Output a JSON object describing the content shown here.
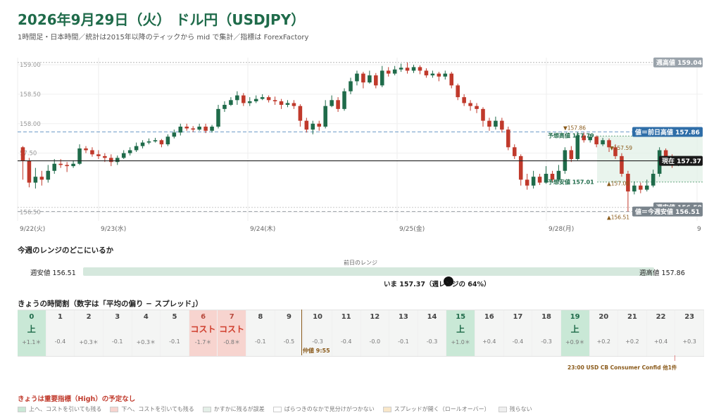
{
  "header": {
    "title": "2026年9月29日（火） ドル円（USDJPY）",
    "subtitle": "1時間足・日本時間／統計は2015年以降のティックから mid で集計／指標は ForexFactory"
  },
  "chart_data": {
    "type": "candlestick",
    "ylim": [
      156.35,
      159.12
    ],
    "y_ticks": [
      "159.00",
      "158.50",
      "158.00",
      "57.50",
      "156.50"
    ],
    "x_ticks": [
      "9/22(火)",
      "9/23(水)",
      "9/24(木)",
      "9/25(金)",
      "9/28(月)",
      "9"
    ],
    "colors": {
      "up": "#1f6b4a",
      "down": "#c0392b"
    },
    "candles": [
      [
        157.6,
        157.37,
        157.62,
        157.05
      ],
      [
        157.37,
        157.0,
        157.42,
        156.92
      ],
      [
        157.0,
        157.1,
        157.25,
        156.9
      ],
      [
        157.1,
        157.05,
        157.2,
        156.95
      ],
      [
        157.05,
        157.2,
        157.3,
        157.0
      ],
      [
        157.2,
        157.32,
        157.4,
        157.15
      ],
      [
        157.32,
        157.3,
        157.4,
        157.25
      ],
      [
        157.3,
        157.28,
        157.35,
        157.18
      ],
      [
        157.28,
        157.32,
        157.38,
        157.25
      ],
      [
        157.32,
        157.58,
        157.65,
        157.3
      ],
      [
        157.58,
        157.55,
        157.62,
        157.5
      ],
      [
        157.55,
        157.48,
        157.6,
        157.44
      ],
      [
        157.48,
        157.45,
        157.55,
        157.4
      ],
      [
        157.45,
        157.42,
        157.5,
        157.35
      ],
      [
        157.42,
        157.35,
        157.48,
        157.28
      ],
      [
        157.35,
        157.42,
        157.46,
        157.3
      ],
      [
        157.42,
        157.5,
        157.55,
        157.4
      ],
      [
        157.5,
        157.55,
        157.6,
        157.46
      ],
      [
        157.55,
        157.62,
        157.68,
        157.52
      ],
      [
        157.62,
        157.68,
        157.72,
        157.58
      ],
      [
        157.68,
        157.7,
        157.75,
        157.65
      ],
      [
        157.7,
        157.72,
        157.76,
        157.68
      ],
      [
        157.72,
        157.65,
        157.74,
        157.6
      ],
      [
        157.65,
        157.78,
        157.82,
        157.62
      ],
      [
        157.78,
        157.85,
        157.9,
        157.75
      ],
      [
        157.85,
        157.95,
        158.0,
        157.8
      ],
      [
        157.95,
        157.92,
        158.0,
        157.88
      ],
      [
        157.92,
        157.9,
        157.96,
        157.86
      ],
      [
        157.9,
        157.95,
        158.0,
        157.88
      ],
      [
        157.95,
        157.88,
        158.0,
        157.84
      ],
      [
        157.88,
        157.95,
        157.98,
        157.85
      ],
      [
        157.95,
        158.25,
        158.32,
        157.92
      ],
      [
        158.25,
        158.32,
        158.38,
        158.2
      ],
      [
        158.32,
        158.4,
        158.45,
        158.3
      ],
      [
        158.4,
        158.48,
        158.55,
        158.32
      ],
      [
        158.48,
        158.35,
        158.52,
        158.3
      ],
      [
        158.35,
        158.38,
        158.45,
        158.3
      ],
      [
        158.38,
        158.42,
        158.48,
        158.35
      ],
      [
        158.42,
        158.45,
        158.5,
        158.4
      ],
      [
        158.45,
        158.4,
        158.48,
        158.36
      ],
      [
        158.4,
        158.38,
        158.46,
        158.32
      ],
      [
        158.38,
        158.32,
        158.42,
        158.25
      ],
      [
        158.32,
        158.35,
        158.4,
        158.28
      ],
      [
        158.35,
        158.3,
        158.4,
        158.25
      ],
      [
        158.3,
        158.05,
        158.33,
        157.95
      ],
      [
        158.05,
        157.9,
        158.1,
        157.85
      ],
      [
        157.9,
        158.0,
        158.05,
        157.82
      ],
      [
        158.0,
        157.95,
        158.05,
        157.88
      ],
      [
        157.95,
        158.3,
        158.4,
        157.92
      ],
      [
        158.3,
        158.4,
        158.48,
        158.28
      ],
      [
        158.4,
        158.25,
        158.45,
        158.2
      ],
      [
        158.25,
        158.55,
        158.6,
        158.22
      ],
      [
        158.55,
        158.72,
        158.78,
        158.5
      ],
      [
        158.72,
        158.85,
        158.9,
        158.65
      ],
      [
        158.85,
        158.7,
        158.88,
        158.6
      ],
      [
        158.7,
        158.82,
        158.9,
        158.68
      ],
      [
        158.82,
        158.65,
        158.86,
        158.6
      ],
      [
        158.65,
        158.9,
        158.98,
        158.62
      ],
      [
        158.9,
        158.85,
        158.96,
        158.8
      ],
      [
        158.85,
        158.92,
        158.98,
        158.82
      ],
      [
        158.92,
        158.95,
        159.02,
        158.88
      ],
      [
        158.95,
        158.9,
        159.04,
        158.85
      ],
      [
        158.9,
        158.96,
        159.0,
        158.86
      ],
      [
        158.96,
        158.9,
        158.99,
        158.84
      ],
      [
        158.9,
        158.82,
        158.94,
        158.78
      ],
      [
        158.82,
        158.85,
        158.9,
        158.78
      ],
      [
        158.85,
        158.8,
        158.88,
        158.72
      ],
      [
        158.8,
        158.85,
        158.9,
        158.75
      ],
      [
        158.85,
        158.65,
        158.88,
        158.6
      ],
      [
        158.65,
        158.45,
        158.68,
        158.4
      ],
      [
        158.45,
        158.35,
        158.5,
        158.3
      ],
      [
        158.35,
        158.3,
        158.4,
        158.22
      ],
      [
        158.3,
        158.25,
        158.35,
        158.18
      ],
      [
        158.25,
        158.05,
        158.28,
        157.95
      ],
      [
        158.05,
        157.95,
        158.1,
        157.88
      ],
      [
        157.95,
        158.05,
        158.12,
        157.9
      ],
      [
        158.05,
        157.9,
        158.1,
        157.85
      ],
      [
        157.9,
        157.6,
        157.95,
        157.55
      ],
      [
        157.6,
        157.45,
        157.65,
        157.4
      ],
      [
        157.45,
        157.05,
        157.48,
        156.95
      ],
      [
        157.05,
        156.95,
        157.15,
        156.88
      ],
      [
        156.95,
        157.1,
        157.2,
        156.9
      ],
      [
        157.1,
        157.0,
        157.15,
        156.96
      ],
      [
        157.0,
        157.15,
        157.28,
        156.98
      ],
      [
        157.15,
        157.05,
        157.2,
        157.0
      ],
      [
        157.05,
        157.2,
        157.3,
        157.02
      ],
      [
        157.2,
        157.55,
        157.6,
        157.15
      ],
      [
        157.55,
        157.4,
        157.62,
        157.35
      ],
      [
        157.4,
        157.8,
        157.86,
        157.38
      ],
      [
        157.8,
        157.72,
        157.85,
        157.68
      ],
      [
        157.72,
        157.78,
        157.82,
        157.68
      ],
      [
        157.78,
        157.65,
        157.8,
        157.6
      ],
      [
        157.65,
        157.72,
        157.76,
        157.62
      ],
      [
        157.72,
        157.6,
        157.75,
        157.52
      ],
      [
        157.6,
        157.45,
        157.65,
        157.4
      ],
      [
        157.45,
        157.15,
        157.5,
        157.1
      ],
      [
        157.15,
        156.85,
        157.2,
        156.51
      ],
      [
        156.85,
        156.95,
        157.02,
        156.8
      ],
      [
        156.95,
        156.88,
        157.0,
        156.82
      ],
      [
        156.88,
        156.95,
        157.05,
        156.85
      ],
      [
        156.95,
        157.15,
        157.22,
        156.92
      ],
      [
        157.15,
        157.55,
        157.6,
        157.1
      ],
      [
        157.55,
        157.4,
        157.58,
        157.3
      ],
      [
        157.4,
        157.3,
        157.48,
        157.25
      ],
      [
        157.3,
        157.37,
        157.45,
        157.28
      ]
    ],
    "levels": {
      "week_high_line": 159.04,
      "prev_day_high_line": 157.86,
      "current_line": 157.37,
      "week_low_line": 156.51,
      "forecast_high": 157.79,
      "forecast_low": 157.01
    },
    "right_labels": {
      "week_high": "週高値 159.04",
      "prev_day_high": "値＝前日高値 157.86",
      "current": "現在 157.37",
      "week_low_line": "週安値 156.58",
      "week_low_today": "値＝今週安値 156.51"
    },
    "annotations": {
      "forecast_high": "予想高値 157.79",
      "forecast_low": "予想安値 157.01",
      "prev_high_marker": "▼157.86",
      "today_high_marker": "▼157.59",
      "today_low_marker": "▲157.00",
      "week_low_marker": "▲156.51"
    },
    "colors_levels": {
      "week_high_bg": "#9aa3ab",
      "prev_high_bg": "#2f6ea8",
      "current_bg": "#1a1a1a",
      "low_bg": "#7a848c",
      "forecast": "#1f6b4a",
      "marker": "#8a5a1a"
    }
  },
  "range": {
    "heading": "今週のレンジのどこにいるか",
    "caption": "前日のレンジ",
    "low_label": "週安値 156.51",
    "high_label": "週高値 157.86",
    "now_label": "いま 157.37（週レンジの 64%）",
    "position_pct": 64
  },
  "schedule": {
    "heading": "きょうの時間割（数字は「平均の偏り − スプレッド」）",
    "hours": [
      {
        "h": "0",
        "label": "上",
        "value": "+1.1＊",
        "type": "up"
      },
      {
        "h": "1",
        "label": "",
        "value": "-0.4",
        "type": ""
      },
      {
        "h": "2",
        "label": "",
        "value": "+0.3＊",
        "type": ""
      },
      {
        "h": "3",
        "label": "",
        "value": "-0.1",
        "type": ""
      },
      {
        "h": "4",
        "label": "",
        "value": "+0.3＊",
        "type": ""
      },
      {
        "h": "5",
        "label": "",
        "value": "-0.1",
        "type": ""
      },
      {
        "h": "6",
        "label": "コスト",
        "value": "-1.7＊",
        "type": "cost"
      },
      {
        "h": "7",
        "label": "コスト",
        "value": "-0.8＊",
        "type": "cost"
      },
      {
        "h": "8",
        "label": "",
        "value": "-0.1",
        "type": ""
      },
      {
        "h": "9",
        "label": "",
        "value": "-0.5",
        "type": ""
      },
      {
        "h": "10",
        "label": "",
        "value": "-0.3",
        "type": ""
      },
      {
        "h": "11",
        "label": "",
        "value": "-0.4",
        "type": ""
      },
      {
        "h": "12",
        "label": "",
        "value": "-0.0",
        "type": ""
      },
      {
        "h": "13",
        "label": "",
        "value": "-0.1",
        "type": ""
      },
      {
        "h": "14",
        "label": "",
        "value": "-0.3",
        "type": ""
      },
      {
        "h": "15",
        "label": "上",
        "value": "+1.0＊",
        "type": "up"
      },
      {
        "h": "16",
        "label": "",
        "value": "+0.4",
        "type": ""
      },
      {
        "h": "17",
        "label": "",
        "value": "-0.4",
        "type": ""
      },
      {
        "h": "18",
        "label": "",
        "value": "-0.3",
        "type": ""
      },
      {
        "h": "19",
        "label": "上",
        "value": "+0.9＊",
        "type": "up"
      },
      {
        "h": "20",
        "label": "",
        "value": "+0.2",
        "type": ""
      },
      {
        "h": "21",
        "label": "",
        "value": "+0.2",
        "type": ""
      },
      {
        "h": "22",
        "label": "",
        "value": "+0.4",
        "type": ""
      },
      {
        "h": "23",
        "label": "",
        "value": "+0.3",
        "type": ""
      }
    ],
    "nakane_label": "仲値 9:55",
    "event_label": "23:00 USD CB Consumer Confid 他1件"
  },
  "notice": {
    "no_high_events": "きょうは重要指標（High）の予定なし"
  },
  "legend": [
    {
      "text": "上へ、コストを引いても残る",
      "color": "#c9e8d6"
    },
    {
      "text": "下へ、コストを引いても残る",
      "color": "#f7d4cf"
    },
    {
      "text": "かすかに残るが誤差",
      "color": "#e4efe8"
    },
    {
      "text": "ばらつきのなかで見分けがつかない",
      "color": "#ffffff"
    },
    {
      "text": "スプレッドが開く（ロールオーバー）",
      "color": "#f9e7c9"
    },
    {
      "text": "残らない",
      "color": "#eeeeee"
    }
  ]
}
